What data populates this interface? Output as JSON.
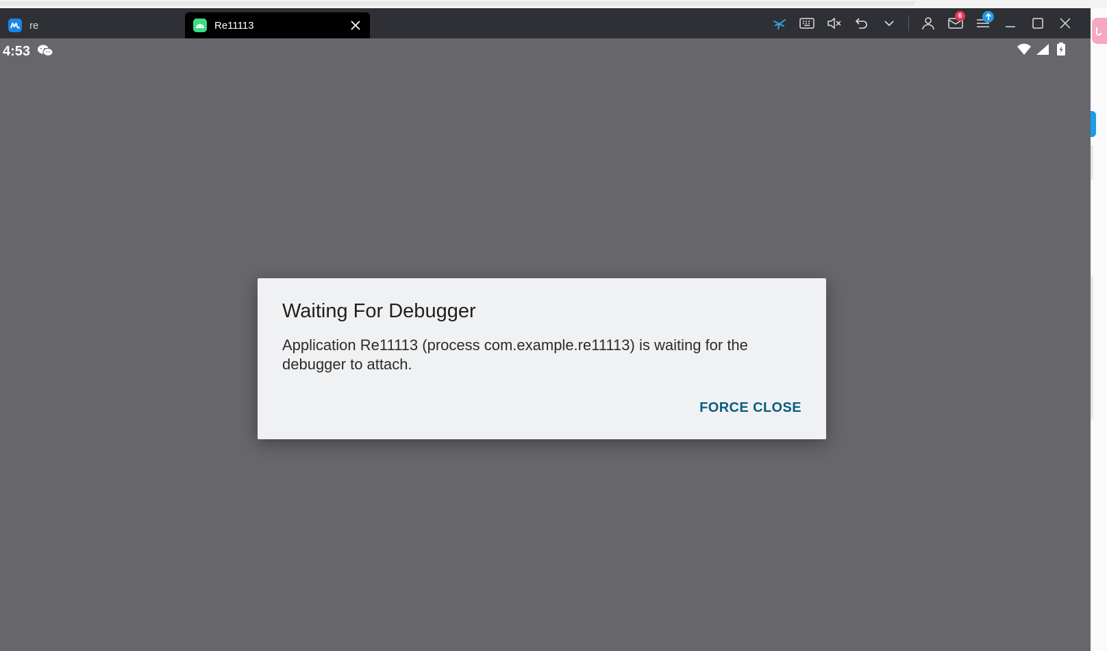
{
  "window": {
    "tabs": [
      {
        "label": "re",
        "active": false
      },
      {
        "label": "Re11113",
        "active": true
      }
    ],
    "toolbar": {
      "icons": [
        "drone-icon",
        "keyboard-icon",
        "volume-mute-icon",
        "undo-icon",
        "chevron-down-icon",
        "user-icon",
        "mail-icon",
        "menu-upload-icon",
        "minimize-icon",
        "maximize-icon",
        "close-icon"
      ],
      "mail_badge": "6"
    },
    "colors": {
      "titlebar": "#2f3035",
      "screen": "#67666b",
      "accent": "#1c9be6",
      "badge": "#e8365d"
    }
  },
  "statusbar": {
    "time": "4:53",
    "icons": [
      "wechat-icon",
      "wifi-icon",
      "signal-icon",
      "battery-charging-icon"
    ]
  },
  "dialog": {
    "title": "Waiting For Debugger",
    "message": "Application Re11113 (process com.example.re11113) is waiting for the debugger to attach.",
    "button_label": "FORCE CLOSE",
    "button_color": "#0b5c7e"
  }
}
